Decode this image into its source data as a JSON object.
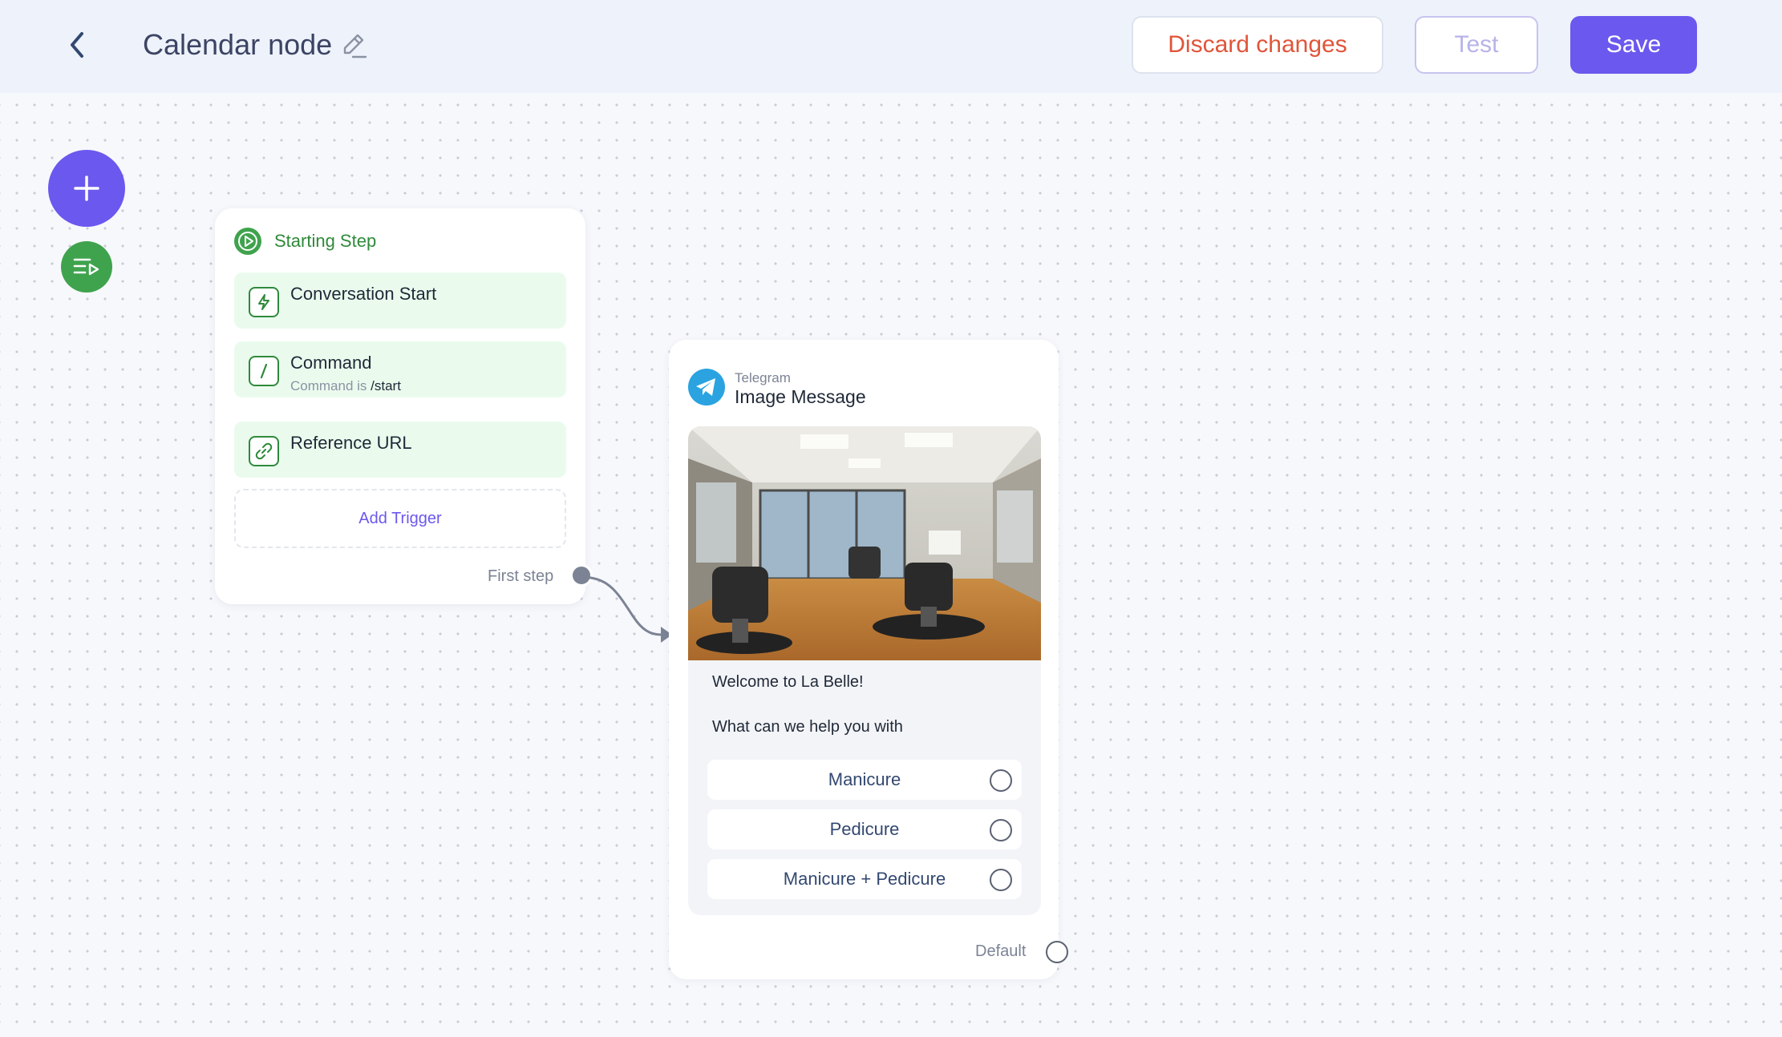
{
  "header": {
    "title": "Calendar node",
    "discard_label": "Discard changes",
    "test_label": "Test",
    "save_label": "Save"
  },
  "colors": {
    "accent": "#6b58ee",
    "green": "#3fa34d",
    "danger": "#e0553a",
    "telegram": "#2aa3e0"
  },
  "start_card": {
    "title": "Starting Step",
    "triggers": [
      {
        "label": "Conversation Start",
        "icon": "lightning-icon"
      },
      {
        "label": "Command",
        "sub_prefix": "Command is",
        "sub_value": "/start",
        "icon": "slash-icon"
      },
      {
        "label": "Reference URL",
        "icon": "link-icon"
      }
    ],
    "add_trigger": "Add Trigger",
    "output_label": "First step"
  },
  "message_card": {
    "channel": "Telegram",
    "type": "Image Message",
    "text_line1": "Welcome to La Belle!",
    "text_line2": "What can we help you with",
    "options": [
      "Manicure",
      "Pedicure",
      "Manicure + Pedicure"
    ],
    "default_label": "Default"
  }
}
